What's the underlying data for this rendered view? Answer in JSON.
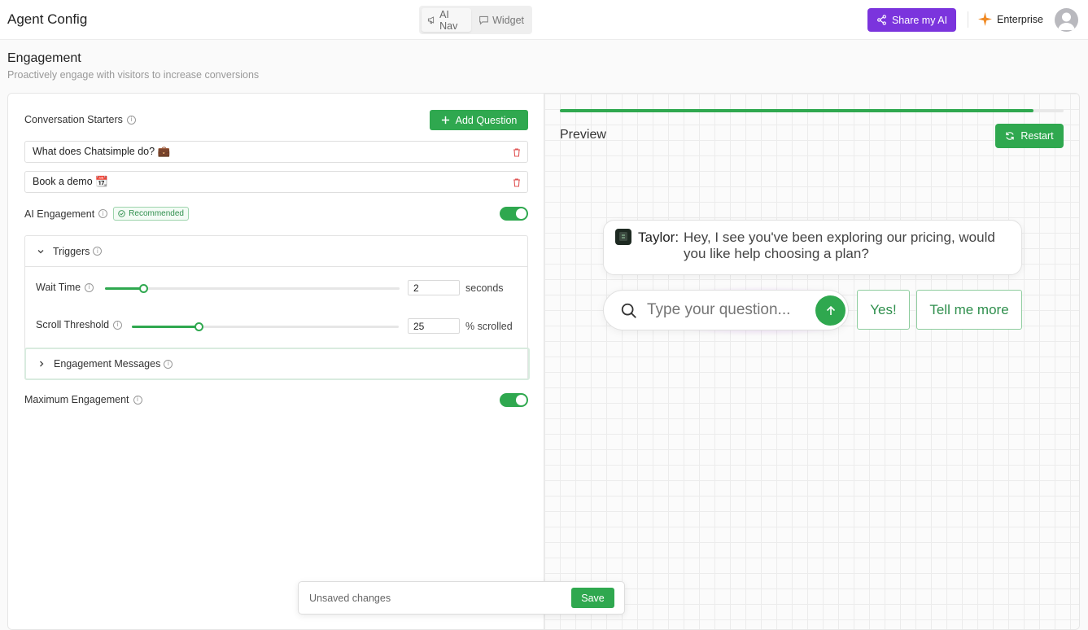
{
  "header": {
    "app_title": "Agent Config",
    "tabs": [
      {
        "label": "AI Nav",
        "icon": "megaphone-icon",
        "active": true
      },
      {
        "label": "Widget",
        "icon": "chat-bubble-icon",
        "active": false
      }
    ],
    "share_label": "Share my AI",
    "enterprise_label": "Enterprise"
  },
  "page": {
    "title": "Engagement",
    "subtitle": "Proactively engage with visitors to increase conversions"
  },
  "config": {
    "conversation_starters_label": "Conversation Starters",
    "add_question_label": "Add Question",
    "starters": [
      "What does Chatsimple do? 💼",
      "Book a demo 📆"
    ],
    "ai_engagement_label": "AI Engagement",
    "recommended_label": "Recommended",
    "ai_engagement_enabled": true,
    "triggers_label": "Triggers",
    "wait_time_label": "Wait Time",
    "wait_time_value": "2",
    "wait_time_unit": "seconds",
    "wait_time_slider_fraction": 0.13,
    "scroll_threshold_label": "Scroll Threshold",
    "scroll_threshold_value": "25",
    "scroll_threshold_unit": "% scrolled",
    "scroll_threshold_slider_fraction": 0.25,
    "engagement_messages_label": "Engagement Messages",
    "maximum_engagement_label": "Maximum Engagement",
    "maximum_engagement_enabled": true
  },
  "preview": {
    "title": "Preview",
    "progress_fraction": 0.94,
    "restart_label": "Restart",
    "bot_name": "Taylor:",
    "bot_message": "Hey, I see you've been exploring our pricing, would you like help choosing a plan?",
    "ask_placeholder": "Type your question...",
    "chips": [
      "Yes!",
      "Tell me more"
    ]
  },
  "savebar": {
    "status": "Unsaved changes",
    "save_label": "Save"
  },
  "colors": {
    "brand_green": "#2fa84f",
    "share_purple": "#7b34dd",
    "enterprise_orange": "#f08a24"
  }
}
